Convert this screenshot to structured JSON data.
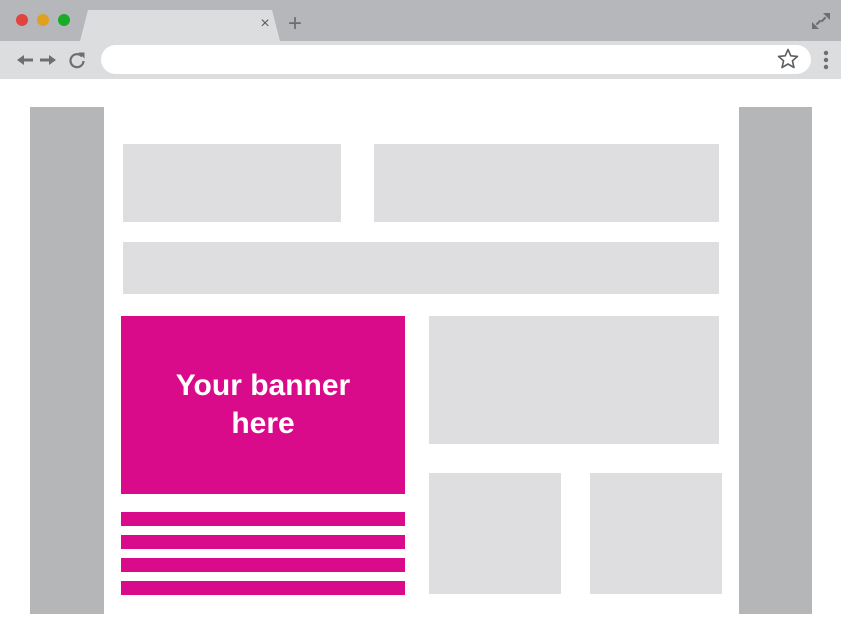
{
  "window": {
    "tab": {
      "title": "",
      "close_glyph": "×"
    },
    "new_tab_glyph": "+",
    "traffic_lights": [
      "#e0443e",
      "#dea123",
      "#1aab29"
    ]
  },
  "toolbar": {
    "icons": [
      "back-arrow-icon",
      "forward-arrow-icon",
      "reload-icon",
      "bookmark-star-icon",
      "kebab-menu-icon"
    ],
    "address": {
      "value": "",
      "placeholder": ""
    }
  },
  "page": {
    "banner": {
      "text": "Your banner\nhere",
      "color": "#d90b8b"
    },
    "placeholder_color": "#dedee0",
    "sidebar_color": "#b5b6b8"
  }
}
